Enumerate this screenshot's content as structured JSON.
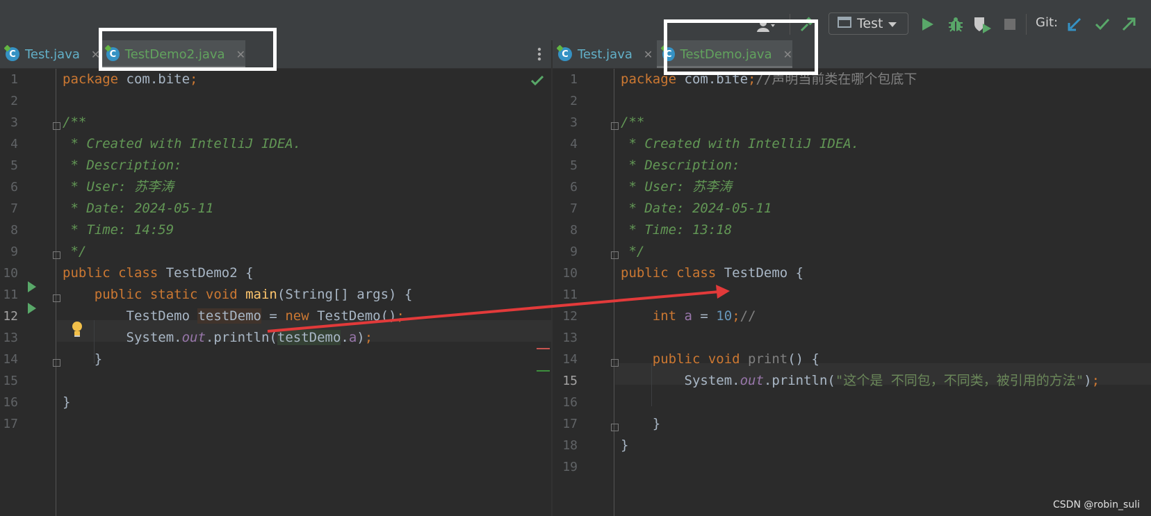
{
  "toolbar": {
    "run_config": "Test",
    "git_label": "Git:"
  },
  "left_pane": {
    "tabs": [
      {
        "label": "Test.java",
        "active": false
      },
      {
        "label": "TestDemo2.java",
        "active": true
      }
    ],
    "line_numbers": [
      "1",
      "2",
      "3",
      "4",
      "5",
      "6",
      "7",
      "8",
      "9",
      "10",
      "11",
      "12",
      "13",
      "14",
      "15",
      "16",
      "17"
    ],
    "current_line": "12",
    "code": {
      "l1_kw": "package",
      "l1_rest": " com.bite",
      "l1_semi": ";",
      "l3": "/**",
      "l4": " * Created with IntelliJ IDEA.",
      "l5": " * Description:",
      "l6": " * User: 苏李涛",
      "l7": " * Date: 2024-05-11",
      "l8": " * Time: 14:59",
      "l9": " */",
      "l10_kw": "public class",
      "l10_rest": " TestDemo2 {",
      "l11_kw1": "    public static void",
      "l11_fn": " main",
      "l11_rest": "(String[] args) {",
      "l12_type": "        TestDemo ",
      "l12_var": "testDemo",
      "l12_eq": " = ",
      "l12_new": "new",
      "l12_rest": " TestDemo()",
      "l12_semi": ";",
      "l13_sys": "        System.",
      "l13_out": "out",
      "l13_println": ".println(",
      "l13_var": "testDemo",
      "l13_dot": ".",
      "l13_a": "a",
      "l13_close": ")",
      "l13_semi": ";",
      "l14": "    }",
      "l16": "}"
    }
  },
  "right_pane": {
    "tabs": [
      {
        "label": "Test.java",
        "active": false
      },
      {
        "label": "TestDemo.java",
        "active": true
      }
    ],
    "line_numbers": [
      "1",
      "2",
      "3",
      "4",
      "5",
      "6",
      "7",
      "8",
      "9",
      "10",
      "11",
      "12",
      "13",
      "14",
      "15",
      "16",
      "17",
      "18",
      "19"
    ],
    "current_line": "15",
    "code": {
      "l1_kw": "package",
      "l1_rest": " com.bite",
      "l1_semi": ";",
      "l1_cm": "//声明当前类在哪个包底下",
      "l3": "/**",
      "l4": " * Created with IntelliJ IDEA.",
      "l5": " * Description:",
      "l6": " * User: 苏李涛",
      "l7": " * Date: 2024-05-11",
      "l8": " * Time: 13:18",
      "l9": " */",
      "l10_kw": "public class",
      "l10_rest": " TestDemo {",
      "l12_kw": "    int",
      "l12_var": " a",
      "l12_eq": " = ",
      "l12_num": "10",
      "l12_semi": ";",
      "l12_cm": "//",
      "l14_kw": "    public void",
      "l14_fn": " print",
      "l14_rest": "() {",
      "l15_sys": "        System.",
      "l15_out": "out",
      "l15_println": ".println(",
      "l15_str": "\"这个是 不同包，不同类，被引用的方法\"",
      "l15_close": ")",
      "l15_semi": ";",
      "l17": "    }",
      "l18": "}"
    }
  },
  "watermark": "CSDN @robin_suli",
  "colors": {
    "annotation_arrow": "#e23a3a",
    "highlight_box": "#ffffff"
  }
}
